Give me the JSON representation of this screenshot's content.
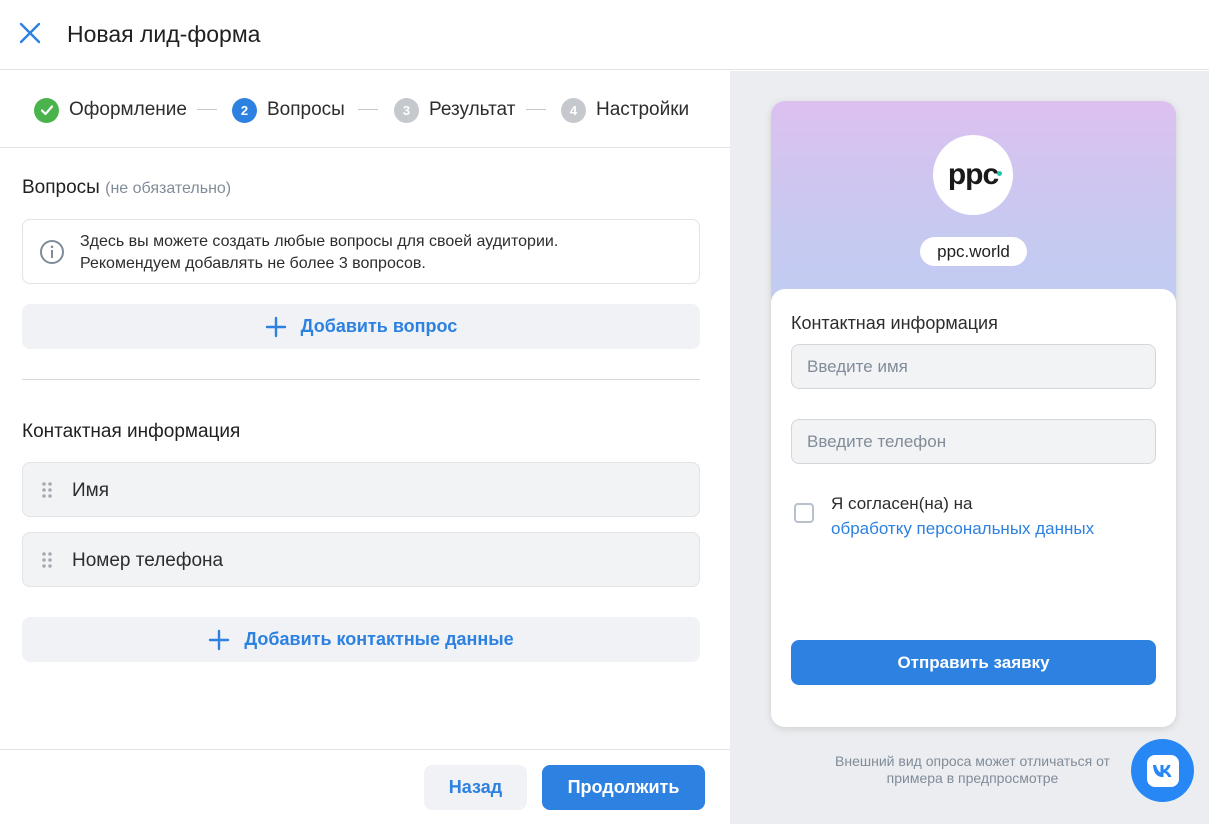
{
  "window": {
    "title": "Новая лид-форма"
  },
  "stepper": {
    "steps": [
      {
        "number": "",
        "label": "Оформление",
        "state": "done"
      },
      {
        "number": "2",
        "label": "Вопросы",
        "state": "active"
      },
      {
        "number": "3",
        "label": "Результат",
        "state": "todo"
      },
      {
        "number": "4",
        "label": "Настройки",
        "state": "todo"
      }
    ]
  },
  "questions": {
    "title": "Вопросы",
    "note": "(не обязательно)",
    "info_line1": "Здесь вы можете создать любые вопросы для своей аудитории.",
    "info_line2": "Рекомендуем добавлять не более 3 вопросов.",
    "add_label": "Добавить вопрос"
  },
  "contacts": {
    "title": "Контактная информация",
    "fields": [
      {
        "label": "Имя"
      },
      {
        "label": "Номер телефона"
      }
    ],
    "add_label": "Добавить контактные данные"
  },
  "footer": {
    "back_label": "Назад",
    "next_label": "Продолжить"
  },
  "preview": {
    "logo_text": "ppc",
    "brand": "ppc.world",
    "section_title": "Контактная информация",
    "name_placeholder": "Введите имя",
    "phone_placeholder": "Введите телефон",
    "consent_text": "Я согласен(на) на",
    "consent_link": "обработку персональных данных",
    "submit_label": "Отправить заявку",
    "disclaimer": "Внешний вид опроса может отличаться от примера в предпросмотре"
  },
  "colors": {
    "accent": "#2d81e0",
    "success": "#4bb34b",
    "inactive": "#c5c8cc",
    "vk": "#2787f5"
  },
  "icons": [
    "close-icon",
    "check-icon",
    "info-icon",
    "plus-icon",
    "drag-handle-icon",
    "vk-logo-icon"
  ]
}
